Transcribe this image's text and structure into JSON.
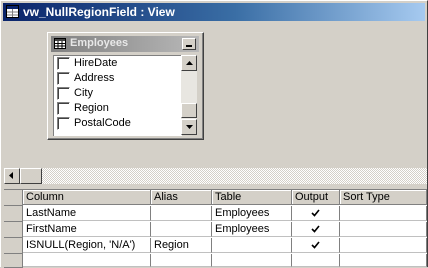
{
  "window": {
    "title": "vw_NullRegionField : View",
    "title_icon": "view-icon"
  },
  "table_box": {
    "name": "Employees",
    "fields": [
      "HireDate",
      "Address",
      "City",
      "Region",
      "PostalCode"
    ]
  },
  "grid": {
    "headers": [
      "Column",
      "Alias",
      "Table",
      "Output",
      "Sort Type"
    ],
    "rows": [
      {
        "column": "LastName",
        "alias": "",
        "table": "Employees",
        "output": true
      },
      {
        "column": "FirstName",
        "alias": "",
        "table": "Employees",
        "output": true
      },
      {
        "column": "ISNULL(Region, 'N/A')",
        "alias": "Region",
        "table": "",
        "output": true
      }
    ]
  },
  "colors": {
    "title_active": "#0a246a",
    "title_gradient_end": "#a6caf0",
    "inactive_title": "#808080",
    "face": "#d4d0c8"
  }
}
